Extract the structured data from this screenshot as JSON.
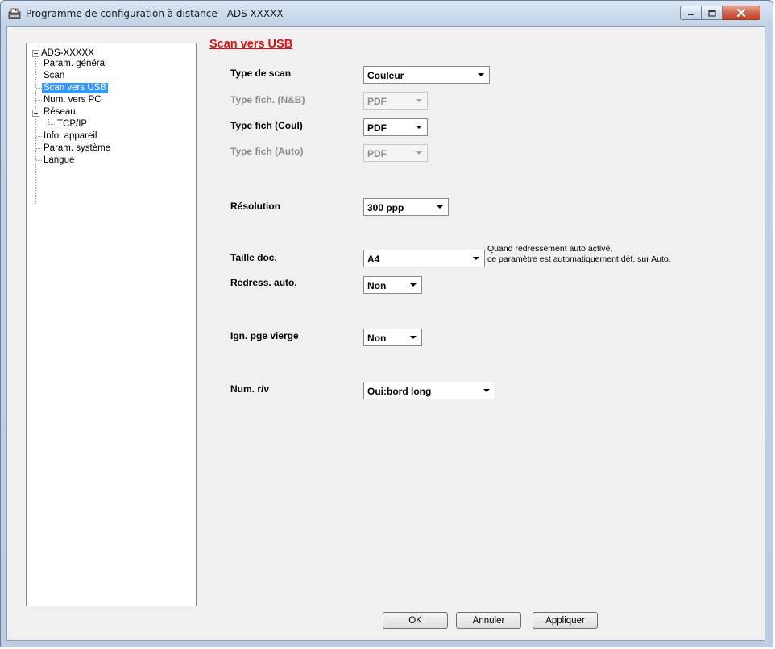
{
  "window": {
    "title": "Programme de configuration à distance - ADS-XXXXX"
  },
  "tree": {
    "root": "ADS-XXXXX",
    "items": [
      {
        "label": "Param. général"
      },
      {
        "label": "Scan"
      },
      {
        "label": "Scan vers USB",
        "selected": true
      },
      {
        "label": "Num. vers PC"
      },
      {
        "label": "Réseau"
      },
      {
        "label": "TCP/IP"
      },
      {
        "label": "Info. appareil"
      },
      {
        "label": "Param. système"
      },
      {
        "label": "Langue"
      }
    ]
  },
  "page": {
    "title": "Scan vers USB",
    "fields": [
      {
        "label": "Type de scan",
        "value": "Couleur",
        "enabled": true
      },
      {
        "label": "Type fich. (N&B)",
        "value": "PDF",
        "enabled": false
      },
      {
        "label": "Type fich (Coul)",
        "value": "PDF",
        "enabled": true
      },
      {
        "label": "Type fich (Auto)",
        "value": "PDF",
        "enabled": false
      },
      {
        "label": "Résolution",
        "value": "300 ppp",
        "enabled": true
      },
      {
        "label": "Taille doc.",
        "value": "A4",
        "enabled": true
      },
      {
        "label": "Redress. auto.",
        "value": "Non",
        "enabled": true
      },
      {
        "label": "Ign. pge vierge",
        "value": "Non",
        "enabled": true
      },
      {
        "label": "Num. r/v",
        "value": "Oui:bord long",
        "enabled": true
      }
    ],
    "note": {
      "line1": "Quand redressement auto activé,",
      "line2": "ce paramètre est automatiquement déf. sur Auto."
    }
  },
  "buttons": {
    "ok": "OK",
    "cancel": "Annuler",
    "apply": "Appliquer"
  },
  "icons": {
    "app": "printer-config-icon",
    "minimize": "minimize-icon",
    "maximize": "maximize-icon",
    "close": "close-icon"
  },
  "colors": {
    "section_title": "#e01010",
    "selection": "#3399ff",
    "close_button": "#c0412a"
  }
}
